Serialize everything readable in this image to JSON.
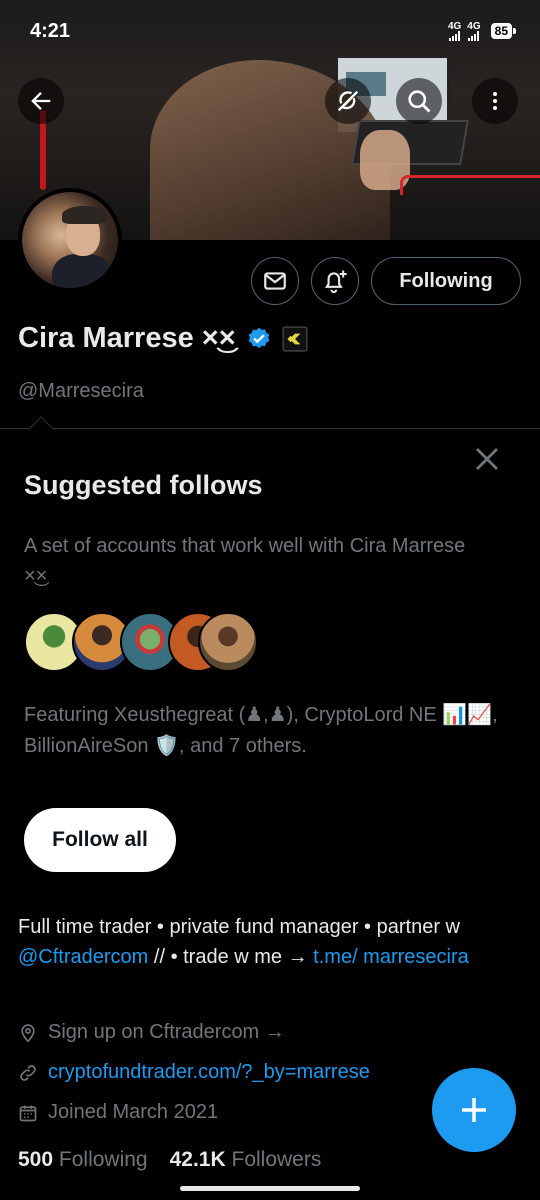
{
  "status_bar": {
    "time": "4:21",
    "network1": "4G",
    "network2": "4G",
    "battery": "85"
  },
  "profile": {
    "name": "Cira Marrese",
    "name_emoji": "×͜×",
    "handle": "@Marresecira",
    "following_label": "Following",
    "verified_color": "#1d9bf0"
  },
  "suggested": {
    "title": "Suggested follows",
    "description": "A set of accounts that work well with Cira Marrese ×͜×",
    "featuring": "Featuring Xeusthegreat (♟,♟), CryptoLord NE 📊📈, BillionAireSon 🛡️, and 7 others.",
    "follow_all_label": "Follow all",
    "avatar_colors": [
      "#c8cf73",
      "#c78b4a",
      "#4e8a7b",
      "#d46a2e",
      "#8b6a45"
    ]
  },
  "bio": {
    "part1": "Full time trader • private fund manager • partner w ",
    "mention": "@Cftradercom",
    "part2": " // • trade w me → ",
    "link": "t.me/ marresecira"
  },
  "meta": {
    "location": "Sign up on Cftradercom →",
    "website": "cryptofundtrader.com/?_by=marrese",
    "joined": "Joined March 2021"
  },
  "stats": {
    "following_count": "500",
    "following_label": "Following",
    "followers_count": "42.1K",
    "followers_label": "Followers"
  },
  "icons": {
    "back": "back-arrow-icon",
    "grok": "grok-icon",
    "search": "search-icon",
    "more": "more-vertical-icon",
    "message": "mail-icon",
    "notify": "bell-plus-icon",
    "verified": "verified-badge-icon",
    "affiliate": "affiliate-badge-icon",
    "close": "close-icon",
    "location": "location-pin-icon",
    "link": "link-icon",
    "calendar": "calendar-icon",
    "compose": "plus-icon"
  }
}
